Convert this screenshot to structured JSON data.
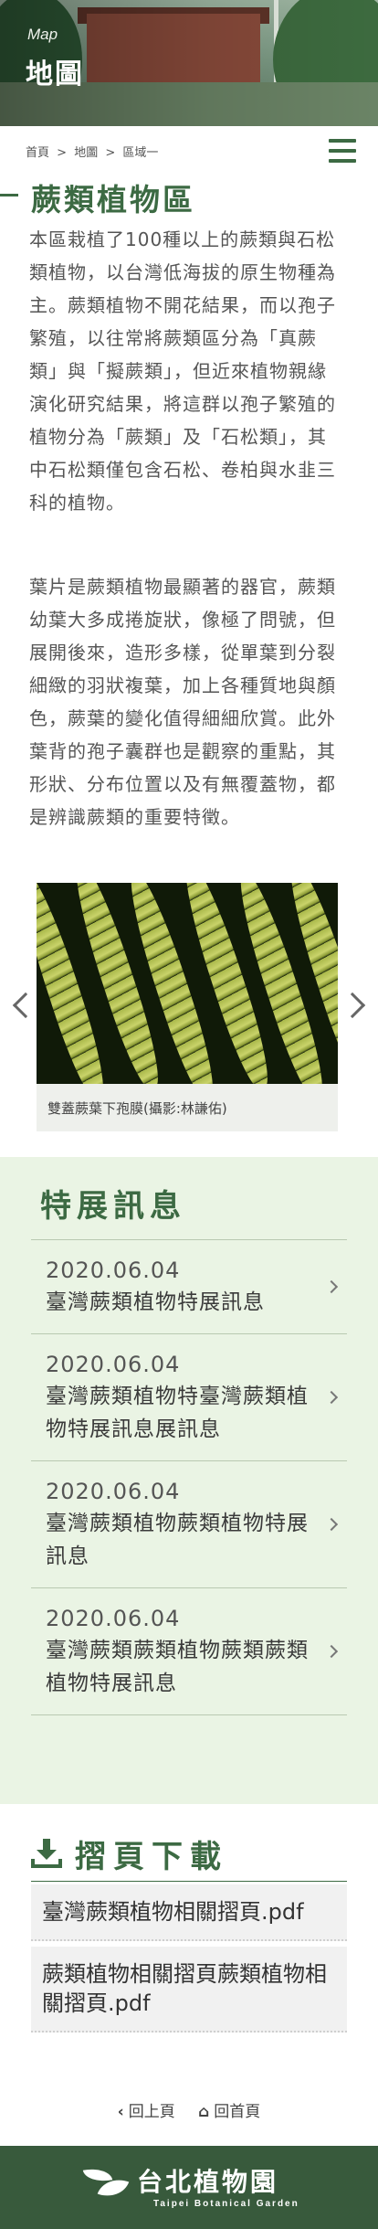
{
  "hero": {
    "en": "Map",
    "zh": "地圖"
  },
  "breadcrumb": [
    "首頁",
    ">",
    "地圖",
    ">",
    "區域一"
  ],
  "menu_icon": "hamburger-menu-icon",
  "page_title": "蕨類植物區",
  "paragraphs": [
    "本區栽植了100種以上的蕨類與石松類植物，以台灣低海拔的原生物種為主。蕨類植物不開花結果，而以孢子繁殖，以往常將蕨類區分為「真蕨類」與「擬蕨類」，但近來植物親緣演化研究結果，將這群以孢子繁殖的植物分為「蕨類」及「石松類」，其中石松類僅包含石松、卷柏與水韭三科的植物。",
    "葉片是蕨類植物最顯著的器官，蕨類幼葉大多成捲旋狀，像極了問號，但展開後來，造形多樣，從單葉到分裂細緻的羽狀複葉，加上各種質地與顏色，蕨葉的變化值得細細欣賞。此外葉背的孢子囊群也是觀察的重點，其形狀、分布位置以及有無覆蓋物，都是辨識蕨類的重要特徵。"
  ],
  "carousel": {
    "caption": "雙蓋蕨葉下孢膜(攝影:林謙佑)"
  },
  "news": {
    "title": "特展訊息",
    "items": [
      {
        "date": "2020.06.04",
        "text": "臺灣蕨類植物特展訊息"
      },
      {
        "date": "2020.06.04",
        "text": "臺灣蕨類植物特臺灣蕨類植物特展訊息展訊息"
      },
      {
        "date": "2020.06.04",
        "text": "臺灣蕨類植物蕨類植物特展訊息"
      },
      {
        "date": "2020.06.04",
        "text": "臺灣蕨類蕨類植物蕨類蕨類植物特展訊息"
      }
    ]
  },
  "downloads": {
    "title": "摺頁下載",
    "items": [
      "臺灣蕨類植物相關摺頁.pdf",
      "蕨類植物相關摺頁蕨類植物相關摺頁.pdf"
    ]
  },
  "bottom_nav": {
    "back": "回上頁",
    "home": "回首頁"
  },
  "footer": {
    "zh": "台北植物園",
    "en": "Taipei Botanical Garden"
  },
  "colors": {
    "brand_green": "#3c6a43",
    "news_bg": "#eaf4e4",
    "footer_bg": "#385a3c"
  }
}
